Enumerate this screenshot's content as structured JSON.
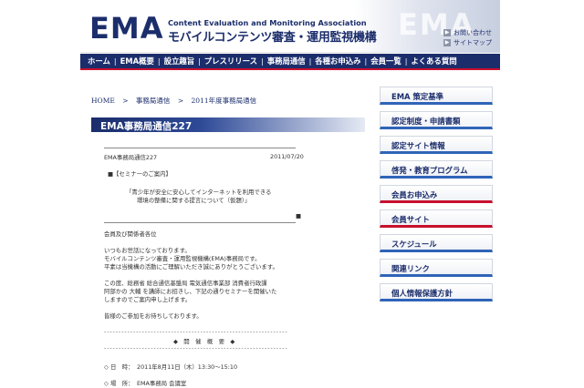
{
  "header": {
    "logo": "EMA",
    "org_en": "Content Evaluation and Monitoring Association",
    "org_jp": "モバイルコンテンツ審査・運用監視機構",
    "deco": "EMA",
    "util_links": [
      "お問い合わせ",
      "サイトマップ"
    ]
  },
  "nav": {
    "items": [
      "ホーム",
      "EMA概要",
      "設立趣旨",
      "プレスリリース",
      "事務局通信",
      "各種お申込み",
      "会員一覧",
      "よくある質問"
    ]
  },
  "breadcrumb": {
    "items": [
      "HOME",
      ">",
      "事務局通信",
      ">",
      "2011年度事務局通信"
    ]
  },
  "page_title": "EMA事務局通信227",
  "article": {
    "header_left": "EMA事務局通信227",
    "header_right": "2011/07/20",
    "seminar_label": "■【セミナーのご案内】",
    "seminar_title_1": "「青少年が安全に安心してインターネットを利用できる",
    "seminar_title_2": "環境の整備に関する提言について（仮題）」",
    "mark": "■",
    "salutation": "会員及び関係者各位",
    "body_1": "いつもお世話になっております。",
    "body_2": "モバイルコンテンツ審査・運用監視機構(EMA)事務局です。",
    "body_3": "平素は当機構の活動にご理解いただき誠にありがとうございます。",
    "body_4": "この度、総務省 総合通信基盤局 電気通信事業部 消費者行政課",
    "body_5": "阿部かの 大輔 を講師にお招きし、下記の通りセミナーを開催いた",
    "body_6": "しますのでご案内申し上げます。",
    "body_7": "皆様のご参加をお待ちしております。",
    "dashes": "- - - - - - - - - - - - - - - - - - - - - - - - - - - - - - - - - - - - - - - - - - - - - - - - - - - - - - - - - - - - - - -",
    "overview_heading": "◆　開　催　概　要　◆",
    "date_label": "◇ 日　時：",
    "date_value": "2011年8月11日（木）13:30〜15:10",
    "place_label": "◇ 場　所：",
    "place_value": "EMA事務局 会議室"
  },
  "sidebar": {
    "items": [
      {
        "label": "EMA 策定基準",
        "accent": "blue"
      },
      {
        "label": "認定制度・申請書類",
        "accent": "blue"
      },
      {
        "label": "認定サイト情報",
        "accent": "blue"
      },
      {
        "label": "啓発・教育プログラム",
        "accent": "blue"
      },
      {
        "label": "会員お申込み",
        "accent": "red"
      },
      {
        "label": "会員サイト",
        "accent": "red"
      },
      {
        "label": "スケジュール",
        "accent": "blue"
      },
      {
        "label": "関連リンク",
        "accent": "blue"
      },
      {
        "label": "個人情報保護方針",
        "accent": "blue"
      }
    ]
  },
  "colors": {
    "brand_navy": "#1b2d6b",
    "accent_red": "#c8102e",
    "accent_blue": "#2f64b8"
  }
}
